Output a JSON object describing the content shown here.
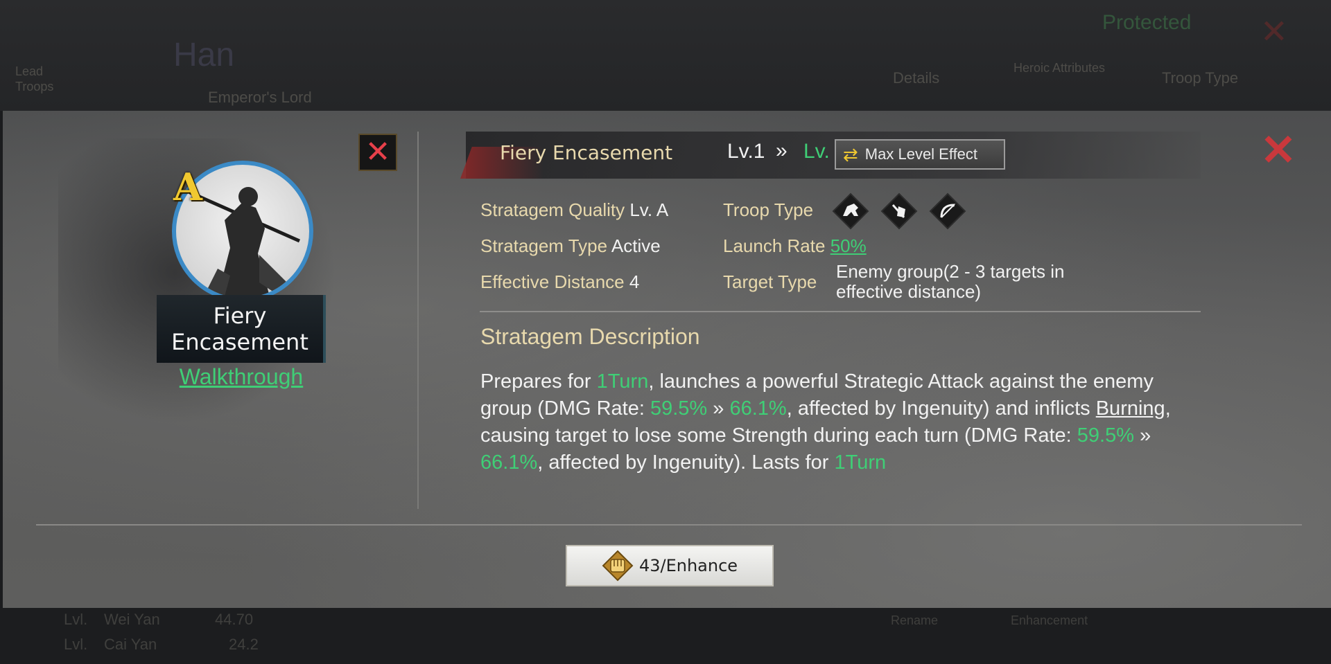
{
  "background": {
    "top_left_label": "Lead Troops",
    "hero_name": "Han",
    "hero_subtitle": "Emperor's Lord",
    "status": "Protected",
    "tabs": [
      "Details",
      "Heroic Attributes",
      "Troop Type"
    ],
    "bottom_row1_label": "Lvl.",
    "bottom_row1_name": "Wei Yan",
    "bottom_row1_val": "44.70",
    "bottom_row2_label": "Lvl.",
    "bottom_row2_name": "Cai Yan",
    "bottom_row2_val": "24.2",
    "bottom_btn1": "Rename",
    "bottom_btn2": "Enhancement"
  },
  "skill_card": {
    "grade": "A",
    "name_line1": "Fiery",
    "name_line2": "Encasement",
    "walkthrough": "Walkthrough"
  },
  "header": {
    "title": "Fiery Encasement",
    "level_current": "Lv.1",
    "level_arrow": "»",
    "level_next": "Lv.",
    "max_level_button": "Max Level Effect"
  },
  "attributes": {
    "quality_label": "Stratagem Quality",
    "quality_value": "Lv. A",
    "type_label": "Stratagem Type",
    "type_value": "Active",
    "distance_label": "Effective Distance",
    "distance_value": "4",
    "troop_label": "Troop Type",
    "troop_icons": [
      "cavalry-icon",
      "infantry-icon",
      "archer-icon"
    ],
    "launch_label": "Launch Rate",
    "launch_value": "50%",
    "target_label": "Target Type",
    "target_value": "Enemy group(2 - 3 targets in effective distance)"
  },
  "description": {
    "title": "Stratagem Description",
    "p1": "Prepares for ",
    "turn1": "1Turn",
    "p2": ", launches a powerful Strategic Attack against the enemy group (DMG Rate: ",
    "dmg1_from": "59.5%",
    "arrow1": " » ",
    "dmg1_to": "66.1%",
    "p3": ", affected by Ingenuity) and inflicts ",
    "burning": "Burning",
    "p4": ", causing target to lose some Strength during each turn (DMG Rate: ",
    "dmg2_from": "59.5%",
    "arrow2": " » ",
    "dmg2_to": "66.1%",
    "p5": ", affected by Ingenuity). Lasts for ",
    "turn2": "1Turn"
  },
  "enhance": {
    "cost": "43",
    "label": " /Enhance"
  },
  "colors": {
    "accent_green": "#3fcf76",
    "label_gold": "#e8d9ad",
    "close_red": "#c9383c",
    "frame_blue": "#3b8ac6"
  }
}
